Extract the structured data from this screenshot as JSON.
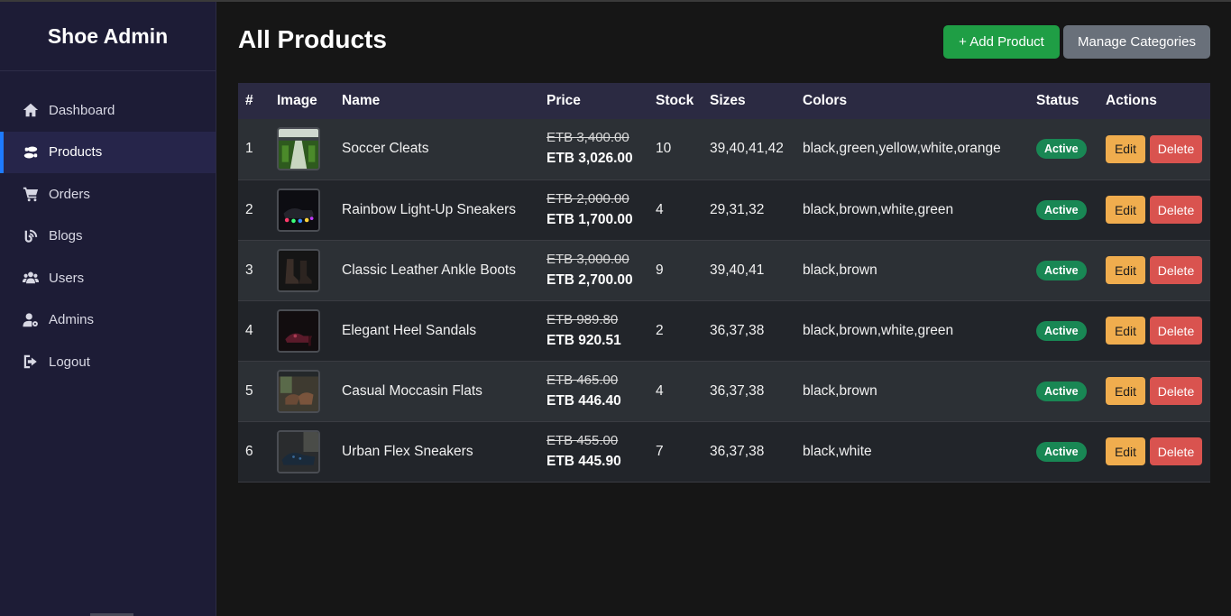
{
  "sidebar": {
    "brand": "Shoe Admin",
    "items": [
      {
        "label": "Dashboard",
        "icon": "home-icon"
      },
      {
        "label": "Products",
        "icon": "shoe-prints-icon",
        "active": true
      },
      {
        "label": "Orders",
        "icon": "cart-icon"
      },
      {
        "label": "Blogs",
        "icon": "blog-icon"
      },
      {
        "label": "Users",
        "icon": "users-icon"
      },
      {
        "label": "Admins",
        "icon": "admin-user-icon"
      },
      {
        "label": "Logout",
        "icon": "logout-icon"
      }
    ]
  },
  "header": {
    "title": "All Products",
    "add_label": "+ Add Product",
    "manage_label": "Manage Categories"
  },
  "table": {
    "columns": [
      "#",
      "Image",
      "Name",
      "Price",
      "Stock",
      "Sizes",
      "Colors",
      "Status",
      "Actions"
    ],
    "rows": [
      {
        "num": "1",
        "name": "Soccer Cleats",
        "old_price": "ETB 3,400.00",
        "new_price": "ETB 3,026.00",
        "stock": "10",
        "sizes": "39,40,41,42",
        "colors": "black,green,yellow,white,orange",
        "status": "Active",
        "edit": "Edit",
        "delete": "Delete"
      },
      {
        "num": "2",
        "name": "Rainbow Light-Up Sneakers",
        "old_price": "ETB 2,000.00",
        "new_price": "ETB 1,700.00",
        "stock": "4",
        "sizes": "29,31,32",
        "colors": "black,brown,white,green",
        "status": "Active",
        "edit": "Edit",
        "delete": "Delete"
      },
      {
        "num": "3",
        "name": "Classic Leather Ankle Boots",
        "old_price": "ETB 3,000.00",
        "new_price": "ETB 2,700.00",
        "stock": "9",
        "sizes": "39,40,41",
        "colors": "black,brown",
        "status": "Active",
        "edit": "Edit",
        "delete": "Delete"
      },
      {
        "num": "4",
        "name": "Elegant Heel Sandals",
        "old_price": "ETB 989.80",
        "new_price": "ETB 920.51",
        "stock": "2",
        "sizes": "36,37,38",
        "colors": "black,brown,white,green",
        "status": "Active",
        "edit": "Edit",
        "delete": "Delete"
      },
      {
        "num": "5",
        "name": "Casual Moccasin Flats",
        "old_price": "ETB 465.00",
        "new_price": "ETB 446.40",
        "stock": "4",
        "sizes": "36,37,38",
        "colors": "black,brown",
        "status": "Active",
        "edit": "Edit",
        "delete": "Delete"
      },
      {
        "num": "6",
        "name": "Urban Flex Sneakers",
        "old_price": "ETB 455.00",
        "new_price": "ETB 445.90",
        "stock": "7",
        "sizes": "36,37,38",
        "colors": "black,white",
        "status": "Active",
        "edit": "Edit",
        "delete": "Delete"
      }
    ]
  },
  "colors": {
    "sidebar_bg": "#1d1c36",
    "active_accent": "#1e7bff",
    "add_button": "#1f9e45",
    "manage_button": "#69707a",
    "badge_active": "#198754",
    "edit_button": "#f0ad4e",
    "delete_button": "#d9534f"
  }
}
